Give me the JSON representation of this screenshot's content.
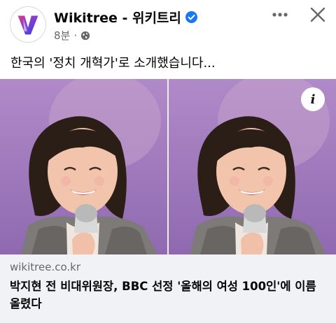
{
  "post": {
    "page_name": "Wikitree - 위키트리",
    "time": "8분",
    "separator": "·",
    "text": "한국의 '정치 개혁가'로 소개했습니다..."
  },
  "link_card": {
    "domain": "wikitree.co.kr",
    "title": "박지현 전 비대위원장, BBC 선정 '올해의 여성 100인'에 이름 올렸다"
  },
  "icons": {
    "avatar": "wikitree-logo",
    "verified": "verified-badge-icon",
    "audience": "globe-icon",
    "more": "more-dots-icon",
    "close": "close-icon",
    "info": "info-icon",
    "info_glyph": "i"
  },
  "colors": {
    "verified_blue": "#1877f2",
    "link_card_bg": "#f0f2f5",
    "secondary_text": "#65676b"
  }
}
